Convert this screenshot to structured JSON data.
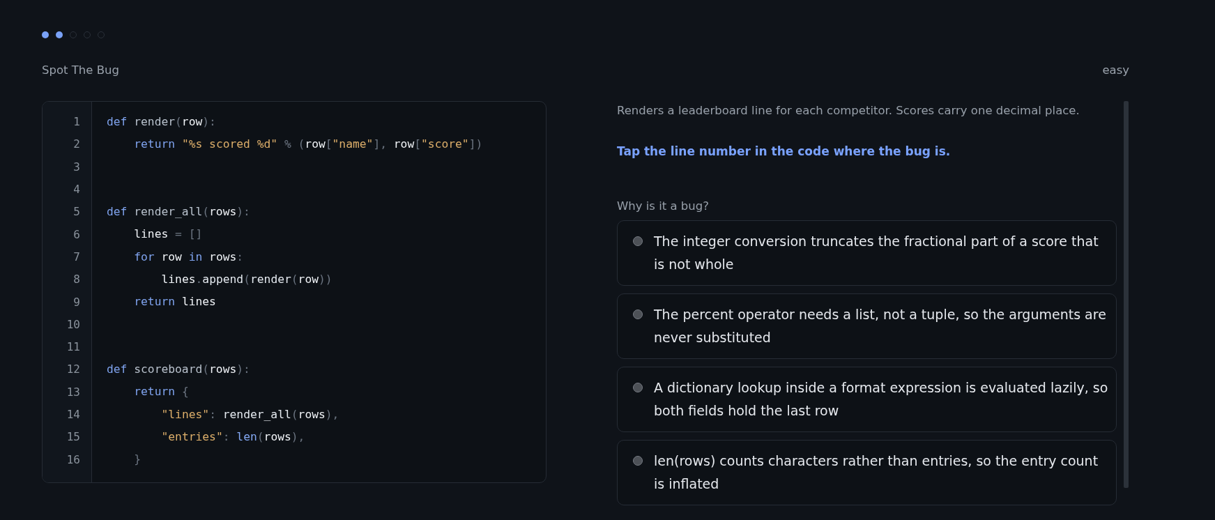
{
  "progress": [
    {
      "done": true
    },
    {
      "done": true
    },
    {
      "done": false
    },
    {
      "done": false
    },
    {
      "done": false
    }
  ],
  "header": {
    "title": "Spot The Bug",
    "difficulty": "easy"
  },
  "code": {
    "lines": [
      {
        "number": "1",
        "tokens": [
          {
            "kind": "keyword",
            "text": "def "
          },
          {
            "kind": "name",
            "text": "render"
          },
          {
            "kind": "punct",
            "text": "("
          },
          {
            "kind": "variable",
            "text": "row"
          },
          {
            "kind": "punct",
            "text": "):"
          }
        ],
        "children": [
          {
            "number": "2",
            "tokens": [
              {
                "kind": "keyword",
                "text": "return "
              },
              {
                "kind": "string",
                "text": "\"%s scored %d\""
              },
              {
                "kind": "punct",
                "text": " % ("
              },
              {
                "kind": "variable",
                "text": "row"
              },
              {
                "kind": "punct",
                "text": "["
              },
              {
                "kind": "string",
                "text": "\"name\""
              },
              {
                "kind": "punct",
                "text": "], "
              },
              {
                "kind": "variable",
                "text": "row"
              },
              {
                "kind": "punct",
                "text": "["
              },
              {
                "kind": "string",
                "text": "\"score\""
              },
              {
                "kind": "punct",
                "text": "])"
              }
            ]
          }
        ]
      },
      {
        "number": "3"
      },
      {
        "number": "4"
      },
      {
        "number": "5",
        "tokens": [
          {
            "kind": "keyword",
            "text": "def "
          },
          {
            "kind": "name",
            "text": "render_all"
          },
          {
            "kind": "punct",
            "text": "("
          },
          {
            "kind": "variable",
            "text": "rows"
          },
          {
            "kind": "punct",
            "text": "):"
          }
        ],
        "children": [
          {
            "number": "6",
            "tokens": [
              {
                "kind": "variable",
                "text": "lines"
              },
              {
                "kind": "punct",
                "text": " = []"
              }
            ]
          },
          {
            "number": "7",
            "tokens": [
              {
                "kind": "keyword",
                "text": "for "
              },
              {
                "kind": "variable",
                "text": "row"
              },
              {
                "kind": "keyword",
                "text": " in "
              },
              {
                "kind": "variable",
                "text": "rows"
              },
              {
                "kind": "punct",
                "text": ":"
              }
            ],
            "children": [
              {
                "number": "8",
                "tokens": [
                  {
                    "kind": "variable",
                    "text": "lines"
                  },
                  {
                    "kind": "punct",
                    "text": "."
                  },
                  {
                    "kind": "call",
                    "text": "append"
                  },
                  {
                    "kind": "punct",
                    "text": "("
                  },
                  {
                    "kind": "call",
                    "text": "render"
                  },
                  {
                    "kind": "punct",
                    "text": "("
                  },
                  {
                    "kind": "variable",
                    "text": "row"
                  },
                  {
                    "kind": "punct",
                    "text": "))"
                  }
                ]
              }
            ]
          },
          {
            "number": "9",
            "tokens": [
              {
                "kind": "keyword",
                "text": "return "
              },
              {
                "kind": "variable",
                "text": "lines"
              }
            ]
          }
        ]
      },
      {
        "number": "10"
      },
      {
        "number": "11"
      },
      {
        "number": "12",
        "tokens": [
          {
            "kind": "keyword",
            "text": "def "
          },
          {
            "kind": "name",
            "text": "scoreboard"
          },
          {
            "kind": "punct",
            "text": "("
          },
          {
            "kind": "variable",
            "text": "rows"
          },
          {
            "kind": "punct",
            "text": "):"
          }
        ],
        "children": [
          {
            "number": "13",
            "tokens": [
              {
                "kind": "keyword",
                "text": "return "
              },
              {
                "kind": "punct",
                "text": "{"
              }
            ],
            "children": [
              {
                "number": "14",
                "tokens": [
                  {
                    "kind": "string",
                    "text": "\"lines\""
                  },
                  {
                    "kind": "punct",
                    "text": ": "
                  },
                  {
                    "kind": "call",
                    "text": "render_all"
                  },
                  {
                    "kind": "punct",
                    "text": "("
                  },
                  {
                    "kind": "variable",
                    "text": "rows"
                  },
                  {
                    "kind": "punct",
                    "text": "),"
                  }
                ]
              },
              {
                "number": "15",
                "tokens": [
                  {
                    "kind": "string",
                    "text": "\"entries\""
                  },
                  {
                    "kind": "punct",
                    "text": ": "
                  },
                  {
                    "kind": "builtin",
                    "text": "len"
                  },
                  {
                    "kind": "punct",
                    "text": "("
                  },
                  {
                    "kind": "variable",
                    "text": "rows"
                  },
                  {
                    "kind": "punct",
                    "text": "),"
                  }
                ]
              }
            ]
          },
          {
            "number": "16",
            "tokens": [
              {
                "kind": "punct",
                "text": "}"
              }
            ]
          }
        ]
      }
    ]
  },
  "prompt": {
    "description": "Renders a leaderboard line for each competitor. Scores carry one decimal place.",
    "instruction": "Tap the line number in the code where the bug is.",
    "question": "Why is it a bug?"
  },
  "options": [
    {
      "text": "The integer conversion truncates the fractional part of a score that is not whole",
      "selected": false
    },
    {
      "text": "The percent operator needs a list, not a tuple, so the arguments are never substituted",
      "selected": false
    },
    {
      "text": "A dictionary lookup inside a format expression is evaluated lazily, so both fields hold the last row",
      "selected": false
    },
    {
      "text": "len(rows) counts characters rather than entries, so the entry count is inflated",
      "selected": false
    }
  ]
}
